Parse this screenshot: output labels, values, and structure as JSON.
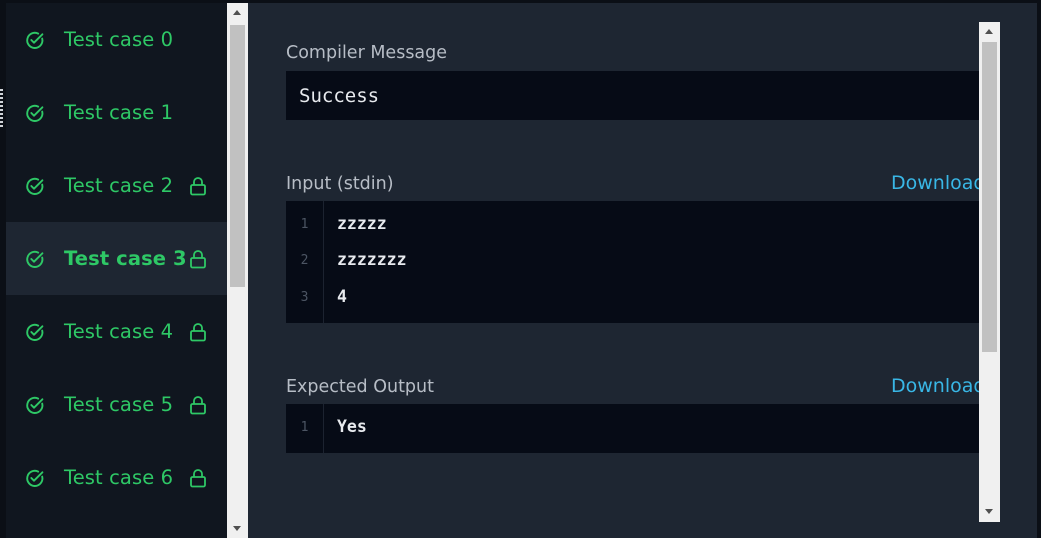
{
  "sidebar": {
    "items": [
      {
        "label": "Test case 0",
        "locked": false,
        "active": false
      },
      {
        "label": "Test case 1",
        "locked": false,
        "active": false
      },
      {
        "label": "Test case 2",
        "locked": true,
        "active": false
      },
      {
        "label": "Test case 3",
        "locked": true,
        "active": true
      },
      {
        "label": "Test case 4",
        "locked": true,
        "active": false
      },
      {
        "label": "Test case 5",
        "locked": true,
        "active": false
      },
      {
        "label": "Test case 6",
        "locked": true,
        "active": false
      }
    ]
  },
  "compiler": {
    "title": "Compiler Message",
    "message": "Success"
  },
  "input": {
    "title": "Input (stdin)",
    "download_label": "Download",
    "lines": [
      {
        "no": "1",
        "text": "zzzzz"
      },
      {
        "no": "2",
        "text": "zzzzzzz"
      },
      {
        "no": "3",
        "text": "4"
      }
    ]
  },
  "expected": {
    "title": "Expected Output",
    "download_label": "Download",
    "lines": [
      {
        "no": "1",
        "text": "Yes"
      }
    ]
  },
  "colors": {
    "success_green": "#2ec866",
    "link_blue": "#39b7e6",
    "panel_bg": "#1e2632",
    "code_bg": "#060b16"
  },
  "icons": {
    "status": "check-circle-icon",
    "lock": "lock-icon"
  }
}
